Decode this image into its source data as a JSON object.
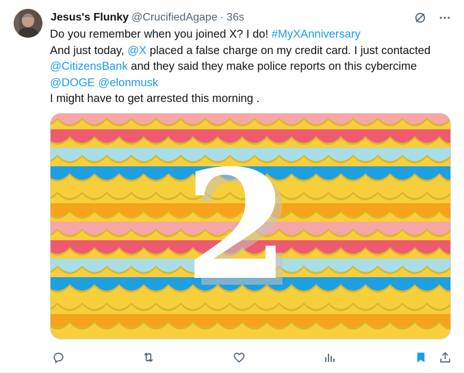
{
  "tweet": {
    "display_name": "Jesus's Flunky",
    "handle": "@CrucifiedAgape",
    "separator": "·",
    "time": "36s",
    "line1_text": "Do you remember when you joined X? I do! ",
    "line1_hashtag": "#MyXAnniversary",
    "line2_pre": "And just today, ",
    "line2_mention": "@X",
    "line2_post": " placed a false charge on my credit card. I just contacted",
    "line3_mention": "@CitizensBank",
    "line3_post": " and they said they make police reports on this cybercime",
    "line4_mention1": "@DOGE",
    "line4_space": " ",
    "line4_mention2": "@elonmusk",
    "line5_text": "I might have to get arrested this morning .",
    "image_numeral": "2"
  },
  "colors": {
    "link": "#1d9bf0",
    "bookmark_active": "#1d9bf0",
    "muted": "#536471",
    "pink": "#f4a7a6",
    "coral": "#ee5a6f",
    "blue": "#1e9fe0",
    "light_blue": "#a9dde7",
    "orange": "#f7a21b",
    "yellow": "#f6cf3a"
  },
  "icons": {
    "top": [
      "grok-icon",
      "more-icon"
    ],
    "actions": [
      "reply-icon",
      "retweet-icon",
      "like-icon",
      "views-icon",
      "bookmark-icon",
      "share-icon"
    ]
  }
}
